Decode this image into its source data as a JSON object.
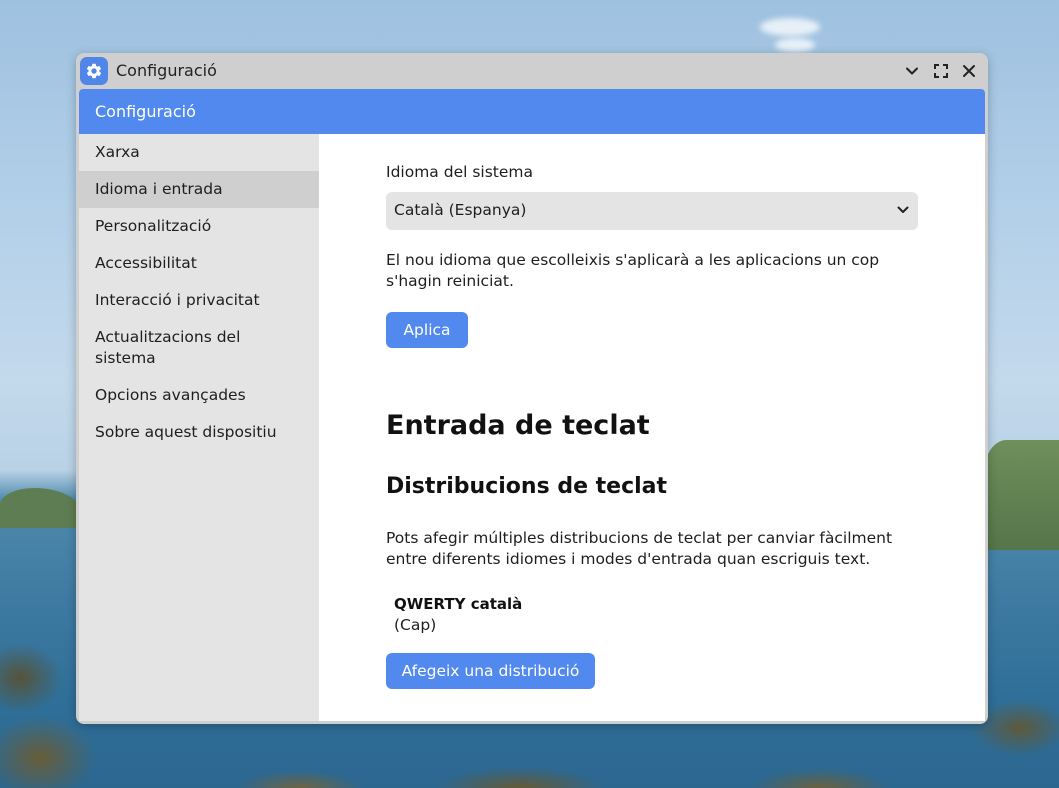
{
  "window": {
    "title": "Configuració",
    "controls": {
      "minimize_icon": "chevron-down-icon",
      "maximize_icon": "fullscreen-icon",
      "close_icon": "close-icon"
    }
  },
  "header": {
    "title": "Configuració"
  },
  "sidebar": {
    "items": [
      {
        "label": "Xarxa",
        "active": false
      },
      {
        "label": "Idioma i entrada",
        "active": true
      },
      {
        "label": "Personalització",
        "active": false
      },
      {
        "label": "Accessibilitat",
        "active": false
      },
      {
        "label": "Interacció i privacitat",
        "active": false
      },
      {
        "label": "Actualitzacions del sistema",
        "active": false
      },
      {
        "label": "Opcions avançades",
        "active": false
      },
      {
        "label": "Sobre aquest dispositiu",
        "active": false
      }
    ]
  },
  "language": {
    "label": "Idioma del sistema",
    "selected": "Català (Espanya)",
    "description": "El nou idioma que escolleixis s'aplicarà a les aplicacions un cop s'hagin reiniciat.",
    "apply_button": "Aplica"
  },
  "keyboard": {
    "heading": "Entrada de teclat",
    "subheading": "Distribucions de teclat",
    "description": "Pots afegir múltiples distribucions de teclat per canviar fàcilment entre diferents idiomes i modes d'entrada quan escriguis text.",
    "layouts": [
      {
        "name": "QWERTY català",
        "detail": "(Cap)"
      }
    ],
    "add_button": "Afegeix una distribució"
  },
  "colors": {
    "accent": "#5289ee",
    "sidebar_bg": "#e4e4e4",
    "sidebar_active_bg": "#cfcfcf",
    "titlebar_bg": "#cfcfcf"
  }
}
